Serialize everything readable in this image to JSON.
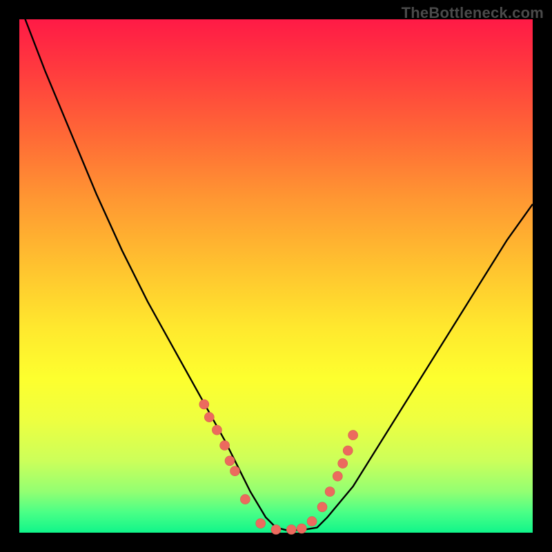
{
  "watermark": "TheBottleneck.com",
  "chart_data": {
    "type": "line",
    "title": "",
    "xlabel": "",
    "ylabel": "",
    "xlim": [
      0,
      100
    ],
    "ylim": [
      0,
      100
    ],
    "grid": false,
    "legend": false,
    "series": [
      {
        "name": "curve",
        "x": [
          0,
          5,
          10,
          15,
          20,
          25,
          30,
          35,
          40,
          42,
          45,
          48,
          50,
          52,
          55,
          58,
          60,
          65,
          70,
          75,
          80,
          85,
          90,
          95,
          100
        ],
        "y": [
          103,
          90,
          78,
          66,
          55,
          45,
          36,
          27,
          18,
          14,
          8,
          3,
          1,
          0.5,
          0.5,
          1,
          3,
          9,
          17,
          25,
          33,
          41,
          49,
          57,
          64
        ]
      },
      {
        "name": "points",
        "type": "scatter",
        "x": [
          36,
          37,
          38.5,
          40,
          41,
          42,
          44,
          47,
          50,
          53,
          55,
          57,
          59,
          60.5,
          62,
          63,
          64,
          65
        ],
        "y": [
          25,
          22.5,
          20,
          17,
          14,
          12,
          6.5,
          1.8,
          0.6,
          0.6,
          0.8,
          2.2,
          5,
          8,
          11,
          13.5,
          16,
          19
        ]
      }
    ]
  }
}
